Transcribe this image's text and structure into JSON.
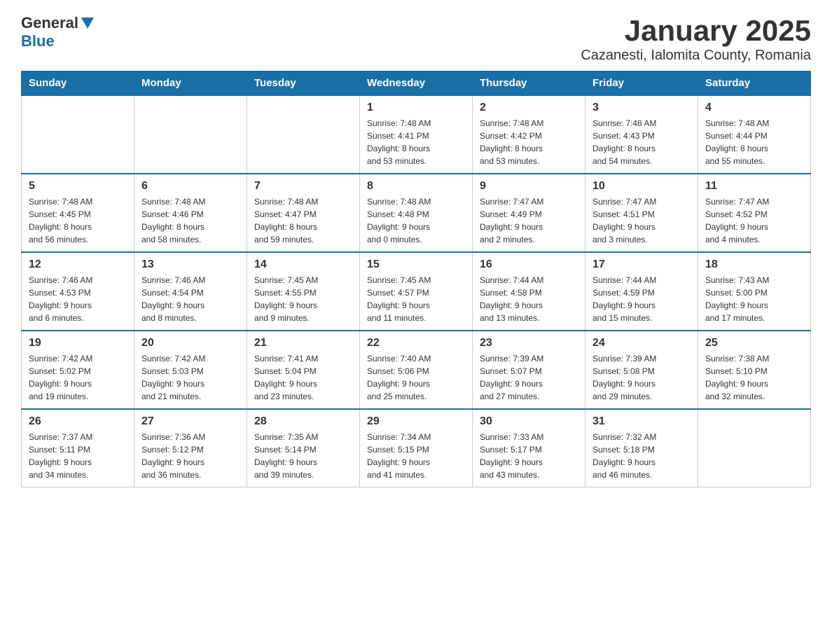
{
  "logo": {
    "text_general": "General",
    "text_blue": "Blue"
  },
  "title": "January 2025",
  "subtitle": "Cazanesti, Ialomita County, Romania",
  "days_of_week": [
    "Sunday",
    "Monday",
    "Tuesday",
    "Wednesday",
    "Thursday",
    "Friday",
    "Saturday"
  ],
  "weeks": [
    [
      {
        "day": "",
        "info": ""
      },
      {
        "day": "",
        "info": ""
      },
      {
        "day": "",
        "info": ""
      },
      {
        "day": "1",
        "info": "Sunrise: 7:48 AM\nSunset: 4:41 PM\nDaylight: 8 hours\nand 53 minutes."
      },
      {
        "day": "2",
        "info": "Sunrise: 7:48 AM\nSunset: 4:42 PM\nDaylight: 8 hours\nand 53 minutes."
      },
      {
        "day": "3",
        "info": "Sunrise: 7:48 AM\nSunset: 4:43 PM\nDaylight: 8 hours\nand 54 minutes."
      },
      {
        "day": "4",
        "info": "Sunrise: 7:48 AM\nSunset: 4:44 PM\nDaylight: 8 hours\nand 55 minutes."
      }
    ],
    [
      {
        "day": "5",
        "info": "Sunrise: 7:48 AM\nSunset: 4:45 PM\nDaylight: 8 hours\nand 56 minutes."
      },
      {
        "day": "6",
        "info": "Sunrise: 7:48 AM\nSunset: 4:46 PM\nDaylight: 8 hours\nand 58 minutes."
      },
      {
        "day": "7",
        "info": "Sunrise: 7:48 AM\nSunset: 4:47 PM\nDaylight: 8 hours\nand 59 minutes."
      },
      {
        "day": "8",
        "info": "Sunrise: 7:48 AM\nSunset: 4:48 PM\nDaylight: 9 hours\nand 0 minutes."
      },
      {
        "day": "9",
        "info": "Sunrise: 7:47 AM\nSunset: 4:49 PM\nDaylight: 9 hours\nand 2 minutes."
      },
      {
        "day": "10",
        "info": "Sunrise: 7:47 AM\nSunset: 4:51 PM\nDaylight: 9 hours\nand 3 minutes."
      },
      {
        "day": "11",
        "info": "Sunrise: 7:47 AM\nSunset: 4:52 PM\nDaylight: 9 hours\nand 4 minutes."
      }
    ],
    [
      {
        "day": "12",
        "info": "Sunrise: 7:46 AM\nSunset: 4:53 PM\nDaylight: 9 hours\nand 6 minutes."
      },
      {
        "day": "13",
        "info": "Sunrise: 7:46 AM\nSunset: 4:54 PM\nDaylight: 9 hours\nand 8 minutes."
      },
      {
        "day": "14",
        "info": "Sunrise: 7:45 AM\nSunset: 4:55 PM\nDaylight: 9 hours\nand 9 minutes."
      },
      {
        "day": "15",
        "info": "Sunrise: 7:45 AM\nSunset: 4:57 PM\nDaylight: 9 hours\nand 11 minutes."
      },
      {
        "day": "16",
        "info": "Sunrise: 7:44 AM\nSunset: 4:58 PM\nDaylight: 9 hours\nand 13 minutes."
      },
      {
        "day": "17",
        "info": "Sunrise: 7:44 AM\nSunset: 4:59 PM\nDaylight: 9 hours\nand 15 minutes."
      },
      {
        "day": "18",
        "info": "Sunrise: 7:43 AM\nSunset: 5:00 PM\nDaylight: 9 hours\nand 17 minutes."
      }
    ],
    [
      {
        "day": "19",
        "info": "Sunrise: 7:42 AM\nSunset: 5:02 PM\nDaylight: 9 hours\nand 19 minutes."
      },
      {
        "day": "20",
        "info": "Sunrise: 7:42 AM\nSunset: 5:03 PM\nDaylight: 9 hours\nand 21 minutes."
      },
      {
        "day": "21",
        "info": "Sunrise: 7:41 AM\nSunset: 5:04 PM\nDaylight: 9 hours\nand 23 minutes."
      },
      {
        "day": "22",
        "info": "Sunrise: 7:40 AM\nSunset: 5:06 PM\nDaylight: 9 hours\nand 25 minutes."
      },
      {
        "day": "23",
        "info": "Sunrise: 7:39 AM\nSunset: 5:07 PM\nDaylight: 9 hours\nand 27 minutes."
      },
      {
        "day": "24",
        "info": "Sunrise: 7:39 AM\nSunset: 5:08 PM\nDaylight: 9 hours\nand 29 minutes."
      },
      {
        "day": "25",
        "info": "Sunrise: 7:38 AM\nSunset: 5:10 PM\nDaylight: 9 hours\nand 32 minutes."
      }
    ],
    [
      {
        "day": "26",
        "info": "Sunrise: 7:37 AM\nSunset: 5:11 PM\nDaylight: 9 hours\nand 34 minutes."
      },
      {
        "day": "27",
        "info": "Sunrise: 7:36 AM\nSunset: 5:12 PM\nDaylight: 9 hours\nand 36 minutes."
      },
      {
        "day": "28",
        "info": "Sunrise: 7:35 AM\nSunset: 5:14 PM\nDaylight: 9 hours\nand 39 minutes."
      },
      {
        "day": "29",
        "info": "Sunrise: 7:34 AM\nSunset: 5:15 PM\nDaylight: 9 hours\nand 41 minutes."
      },
      {
        "day": "30",
        "info": "Sunrise: 7:33 AM\nSunset: 5:17 PM\nDaylight: 9 hours\nand 43 minutes."
      },
      {
        "day": "31",
        "info": "Sunrise: 7:32 AM\nSunset: 5:18 PM\nDaylight: 9 hours\nand 46 minutes."
      },
      {
        "day": "",
        "info": ""
      }
    ]
  ]
}
